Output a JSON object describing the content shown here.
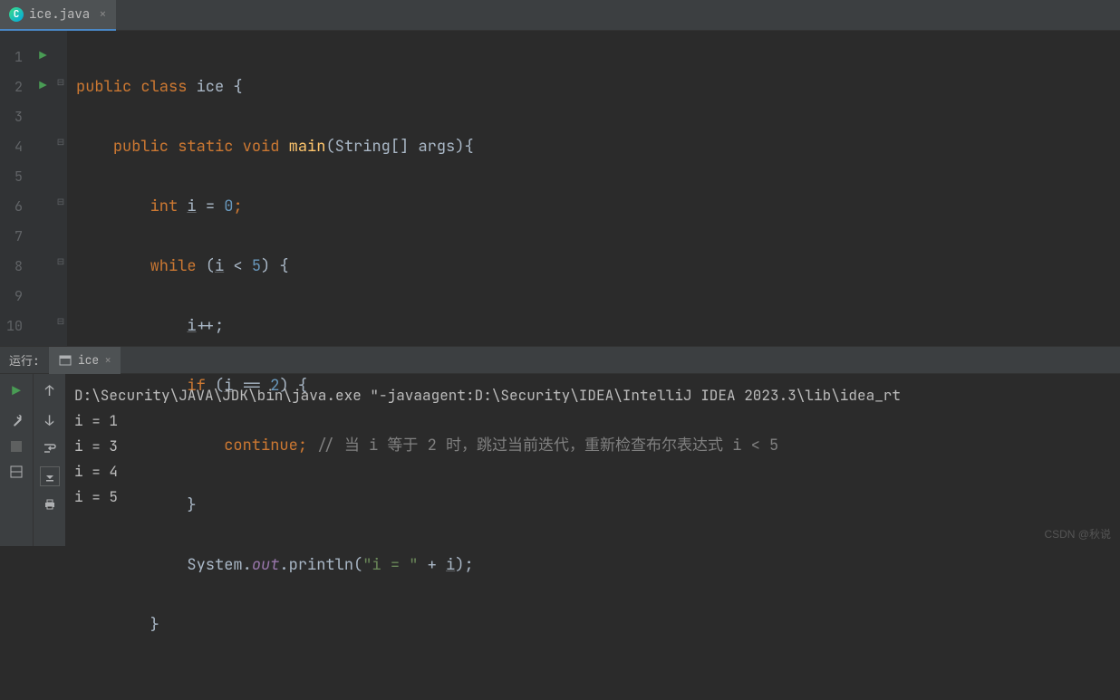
{
  "tab": {
    "name": "ice.java",
    "icon": "C"
  },
  "lines": [
    "1",
    "2",
    "3",
    "4",
    "5",
    "6",
    "7",
    "8",
    "9",
    "10"
  ],
  "code": {
    "l1": {
      "kw1": "public",
      "kw2": "class",
      "id": "ice",
      "br": "{"
    },
    "l2": {
      "kw1": "public",
      "kw2": "static",
      "kw3": "void",
      "fn": "main",
      "par": "(String[] args){"
    },
    "l3": {
      "kw": "int",
      "v": "i",
      "eq": " = ",
      "n": "0",
      "sc": ";"
    },
    "l4": {
      "kw": "while",
      "open": " (",
      "v": "i",
      "cmp": " < ",
      "n": "5",
      "close": ") {"
    },
    "l5": {
      "v": "i",
      "op": "++;"
    },
    "l6": {
      "kw": "if",
      "open": " (",
      "v": "i",
      "cmp": " == ",
      "n": "2",
      "close": ") {"
    },
    "l7": {
      "kw": "continue",
      "sc": ";",
      "cmt": " // 当 i 等于 2 时，跳过当前迭代，重新检查布尔表达式 i < 5"
    },
    "l8": {
      "br": "}"
    },
    "l9": {
      "cls": "System.",
      "fld": "out",
      "dot": ".println(",
      "str": "\"i = \"",
      "plus": " + ",
      "v": "i",
      "end": ");"
    },
    "l10": {
      "br": "}"
    }
  },
  "run": {
    "title": "运行:",
    "tab": "ice"
  },
  "console": {
    "cmd": "D:\\Security\\JAVA\\JDK\\bin\\java.exe \"-javaagent:D:\\Security\\IDEA\\IntelliJ IDEA 2023.3\\lib\\idea_rt",
    "out": [
      "i = 1",
      "i = 3",
      "i = 4",
      "i = 5"
    ]
  },
  "watermark": "CSDN @秋说"
}
